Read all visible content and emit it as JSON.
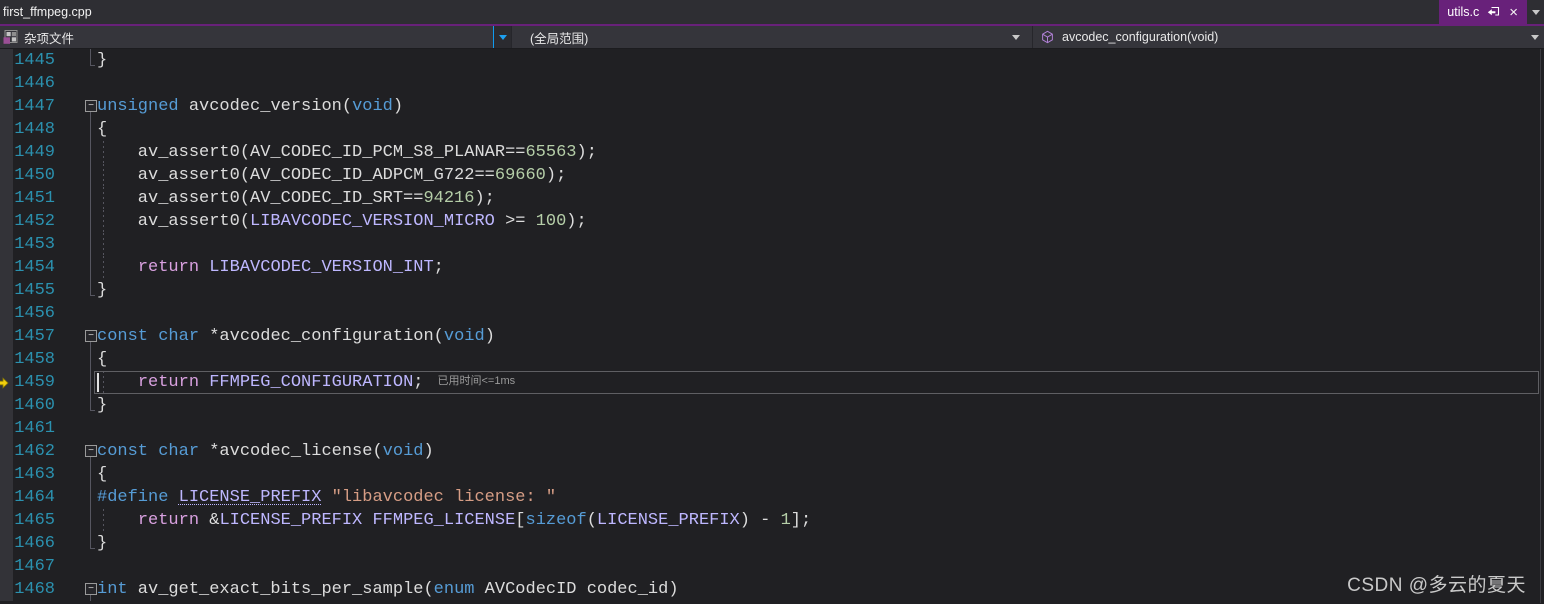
{
  "colors": {
    "accent_purple": "#68217a",
    "nav_focus_blue": "#1ea0f0",
    "editor_background": "#202023",
    "line_number": "#2b91af"
  },
  "tab_bar": {
    "background_tab": {
      "label": "first_ffmpeg.cpp"
    },
    "preview_tab": {
      "label": "utils.c"
    }
  },
  "nav_bar": {
    "project_dropdown": {
      "label": "杂项文件",
      "icon": "misc-files"
    },
    "scope_dropdown": {
      "label": "(全局范围)"
    },
    "member_dropdown": {
      "label": "avcodec_configuration(void)",
      "icon": "method"
    }
  },
  "editor": {
    "current_line": 1459,
    "perf_tip": "已用时间<=1ms",
    "token_colors": {
      "k": "#569cd6",
      "c": "#d8a0df",
      "m": "#beb7ff",
      "mu": "#beb7ff",
      "n": "#b5cea8",
      "s": "#d69d85",
      "p": "#dcdcdc"
    },
    "lines": [
      {
        "n": 1445,
        "sg": true,
        "end": true,
        "segs": [
          [
            "}",
            "p"
          ]
        ]
      },
      {
        "n": 1446,
        "segs": []
      },
      {
        "n": 1447,
        "fold": true,
        "segs": [
          [
            "unsigned",
            "k"
          ],
          [
            " avcodec_version(",
            "p"
          ],
          [
            "void",
            "k"
          ],
          [
            ")",
            "p"
          ]
        ]
      },
      {
        "n": 1448,
        "sg": true,
        "segs": [
          [
            "{",
            "p"
          ]
        ]
      },
      {
        "n": 1449,
        "sg": true,
        "dg": true,
        "segs": [
          [
            "    av_assert0(AV_CODEC_ID_PCM_S8_PLANAR==",
            "p"
          ],
          [
            "65563",
            "n"
          ],
          [
            ");",
            "p"
          ]
        ]
      },
      {
        "n": 1450,
        "sg": true,
        "dg": true,
        "segs": [
          [
            "    av_assert0(AV_CODEC_ID_ADPCM_G722==",
            "p"
          ],
          [
            "69660",
            "n"
          ],
          [
            ");",
            "p"
          ]
        ]
      },
      {
        "n": 1451,
        "sg": true,
        "dg": true,
        "segs": [
          [
            "    av_assert0(AV_CODEC_ID_SRT==",
            "p"
          ],
          [
            "94216",
            "n"
          ],
          [
            ");",
            "p"
          ]
        ]
      },
      {
        "n": 1452,
        "sg": true,
        "dg": true,
        "segs": [
          [
            "    av_assert0(",
            "p"
          ],
          [
            "LIBAVCODEC_VERSION_MICRO",
            "m"
          ],
          [
            " >= ",
            "p"
          ],
          [
            "100",
            "n"
          ],
          [
            ");",
            "p"
          ]
        ]
      },
      {
        "n": 1453,
        "sg": true,
        "dg": true,
        "segs": []
      },
      {
        "n": 1454,
        "sg": true,
        "dg": true,
        "segs": [
          [
            "    ",
            "p"
          ],
          [
            "return",
            "c"
          ],
          [
            " ",
            "p"
          ],
          [
            "LIBAVCODEC_VERSION_INT",
            "m"
          ],
          [
            ";",
            "p"
          ]
        ]
      },
      {
        "n": 1455,
        "sg": true,
        "end": true,
        "segs": [
          [
            "}",
            "p"
          ]
        ]
      },
      {
        "n": 1456,
        "segs": []
      },
      {
        "n": 1457,
        "fold": true,
        "segs": [
          [
            "const",
            "k"
          ],
          [
            " ",
            "p"
          ],
          [
            "char",
            "k"
          ],
          [
            " *avcodec_configuration(",
            "p"
          ],
          [
            "void",
            "k"
          ],
          [
            ")",
            "p"
          ]
        ]
      },
      {
        "n": 1458,
        "sg": true,
        "segs": [
          [
            "{",
            "p"
          ]
        ]
      },
      {
        "n": 1459,
        "sg": true,
        "dg": true,
        "cur": true,
        "arrow": true,
        "tip": "已用时间<=1ms",
        "segs": [
          [
            "    ",
            "p"
          ],
          [
            "return",
            "c"
          ],
          [
            " ",
            "p"
          ],
          [
            "FFMPEG_CONFIGURATION",
            "m"
          ],
          [
            ";",
            "p"
          ]
        ]
      },
      {
        "n": 1460,
        "sg": true,
        "end": true,
        "segs": [
          [
            "}",
            "p"
          ]
        ]
      },
      {
        "n": 1461,
        "segs": []
      },
      {
        "n": 1462,
        "fold": true,
        "segs": [
          [
            "const",
            "k"
          ],
          [
            " ",
            "p"
          ],
          [
            "char",
            "k"
          ],
          [
            " *avcodec_license(",
            "p"
          ],
          [
            "void",
            "k"
          ],
          [
            ")",
            "p"
          ]
        ]
      },
      {
        "n": 1463,
        "sg": true,
        "segs": [
          [
            "{",
            "p"
          ]
        ]
      },
      {
        "n": 1464,
        "sg": true,
        "segs": [
          [
            "#define",
            "k"
          ],
          [
            " ",
            "p"
          ],
          [
            "LICENSE_PREFIX",
            "mu"
          ],
          [
            " ",
            "p"
          ],
          [
            "\"libavcodec license: \"",
            "s"
          ]
        ]
      },
      {
        "n": 1465,
        "sg": true,
        "dg": true,
        "segs": [
          [
            "    ",
            "p"
          ],
          [
            "return",
            "c"
          ],
          [
            " &",
            "p"
          ],
          [
            "LICENSE_PREFIX",
            "m"
          ],
          [
            " ",
            "p"
          ],
          [
            "FFMPEG_LICENSE",
            "m"
          ],
          [
            "[",
            "p"
          ],
          [
            "sizeof",
            "k"
          ],
          [
            "(",
            "p"
          ],
          [
            "LICENSE_PREFIX",
            "m"
          ],
          [
            ") - ",
            "p"
          ],
          [
            "1",
            "n"
          ],
          [
            "];",
            "p"
          ]
        ]
      },
      {
        "n": 1466,
        "sg": true,
        "end": true,
        "segs": [
          [
            "}",
            "p"
          ]
        ]
      },
      {
        "n": 1467,
        "segs": []
      },
      {
        "n": 1468,
        "fold": true,
        "segs": [
          [
            "int",
            "k"
          ],
          [
            " av_get_exact_bits_per_sample(",
            "p"
          ],
          [
            "enum",
            "k"
          ],
          [
            " AVCodecID codec_id)",
            "p"
          ]
        ]
      }
    ]
  },
  "window": {
    "watermark": "CSDN @多云的夏天"
  }
}
